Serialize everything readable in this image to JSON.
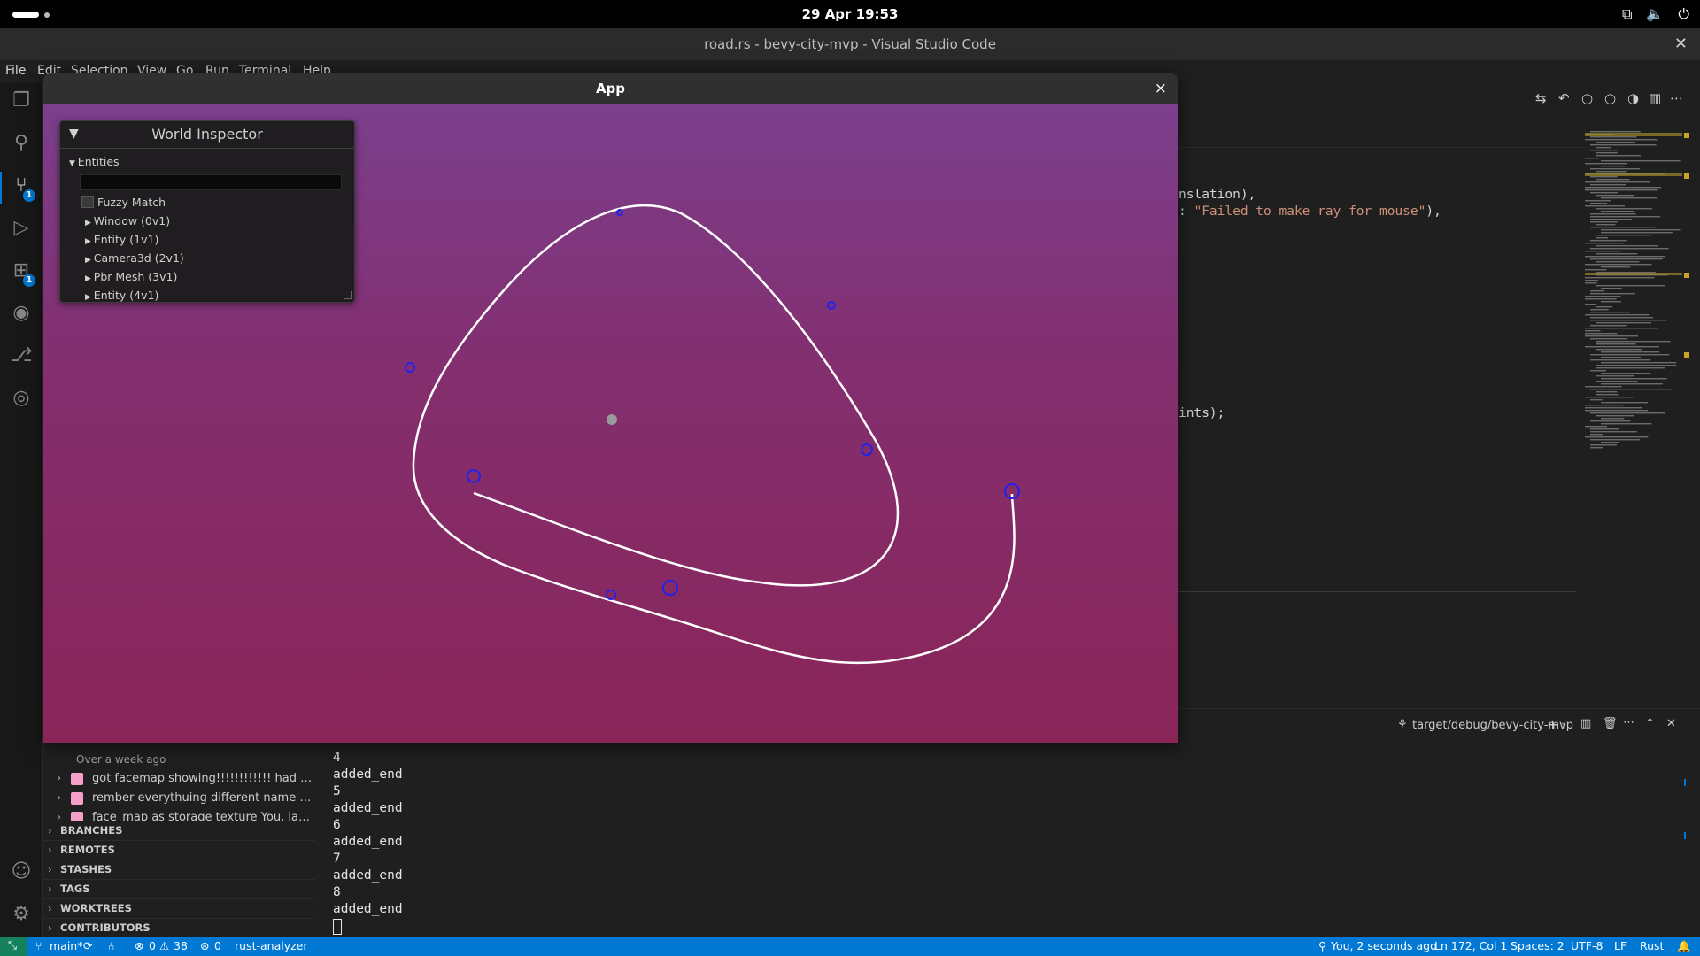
{
  "system": {
    "clock": "29 Apr  19:53",
    "tray_icons": [
      "network-icon",
      "volume-icon",
      "power-icon"
    ]
  },
  "window": {
    "title": "road.rs - bevy-city-mvp - Visual Studio Code",
    "close_glyph": "✕"
  },
  "menu": [
    "File",
    "Edit",
    "Selection",
    "View",
    "Go",
    "Run",
    "Terminal",
    "Help"
  ],
  "activity_bar": {
    "badges": {
      "source_control": "1",
      "extensions": "1"
    }
  },
  "editor": {
    "code_fragments": [
      {
        "text": "nslation),"
      },
      {
        "prefix": ": ",
        "string": "\"Failed to make ray for mouse\"",
        "suffix": "),"
      },
      {
        "text": "ints);"
      }
    ]
  },
  "app": {
    "title": "App",
    "close_glyph": "×",
    "inspector": {
      "title": "World Inspector",
      "section": "Entities",
      "fuzzy_match_label": "Fuzzy Match",
      "entities": [
        "Window (0v1)",
        "Entity (1v1)",
        "Camera3d (2v1)",
        "Pbr Mesh (3v1)",
        "Entity (4v1)"
      ]
    }
  },
  "sidebar": {
    "commit_group_label": "Over a week ago",
    "commits": [
      {
        "text": "got facemap showing!!!!!!!!!!!! had to as ..."
      },
      {
        "text": "rember everythuing different name in w..."
      },
      {
        "text": "face_map as storage texture  You, last w..."
      }
    ],
    "sections": [
      "BRANCHES",
      "REMOTES",
      "STASHES",
      "TAGS",
      "WORKTREES",
      "CONTRIBUTORS"
    ]
  },
  "panel": {
    "terminal_label": "target/debug/bevy-city-mvp",
    "output_lines": [
      "4",
      "added_end",
      "5",
      "added_end",
      "6",
      "added_end",
      "7",
      "added_end",
      "8",
      "added_end"
    ]
  },
  "status_bar": {
    "branch": "main*",
    "errors": "0",
    "warnings": "38",
    "ports": "0",
    "language_server": "rust-analyzer",
    "blame": "You, 2 seconds ago",
    "cursor_position": "Ln 172, Col 1",
    "indentation": "Spaces: 2",
    "encoding": "UTF-8",
    "eol": "LF",
    "language": "Rust"
  }
}
